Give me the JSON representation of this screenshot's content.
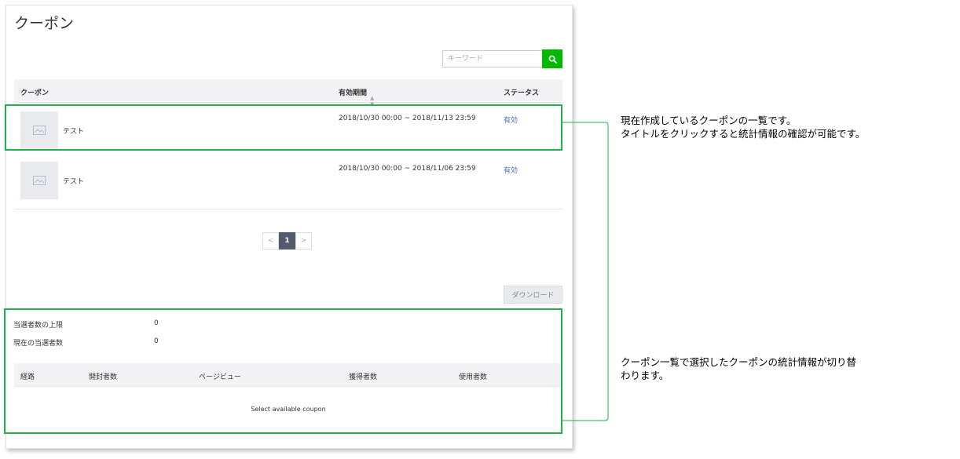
{
  "page": {
    "title": "クーポン"
  },
  "search": {
    "placeholder": "キーワード"
  },
  "coupon_table": {
    "headers": {
      "coupon": "クーポン",
      "period": "有効期間",
      "status": "ステータス"
    },
    "rows": [
      {
        "name": "テスト",
        "period": "2018/10/30 00:00 ~ 2018/11/13 23:59",
        "status": "有効"
      },
      {
        "name": "テスト",
        "period": "2018/10/30 00:00 ~ 2018/11/06 23:59",
        "status": "有効"
      }
    ]
  },
  "pagination": {
    "prev": "<",
    "current": "1",
    "next": ">"
  },
  "download": {
    "label": "ダウンロード"
  },
  "stats": {
    "max_winners_label": "当選者数の上限",
    "max_winners_value": "0",
    "current_winners_label": "現在の当選者数",
    "current_winners_value": "0"
  },
  "stats_table": {
    "headers": {
      "route": "経路",
      "openers": "開封者数",
      "pageviews": "ページビュー",
      "acquirers": "獲得者数",
      "users": "使用者数"
    },
    "empty_message": "Select available coupon"
  },
  "annotations": {
    "note1_line1": "現在作成しているクーポンの一覧です。",
    "note1_line2": "タイトルをクリックすると統計情報の確認が可能です。",
    "note2_line1": "クーポン一覧で選択したクーポンの統計情報が切り替",
    "note2_line2": "わります。"
  },
  "colors": {
    "accent_green": "#00b900",
    "highlight_green": "#22b14c",
    "status_link": "#4a73c8",
    "pager_active": "#545a6d"
  }
}
